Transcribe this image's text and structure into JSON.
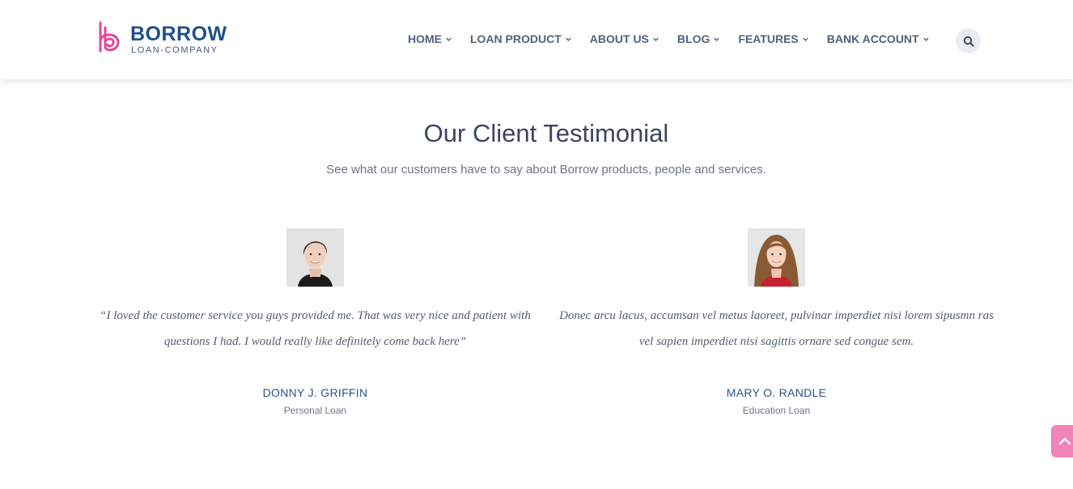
{
  "colors": {
    "brand_primary": "#1f4f8f",
    "brand_accent": "#e0489b",
    "nav_text": "#53617a",
    "heading": "#3c4560",
    "scroll_top_button": "#f184b8"
  },
  "logo": {
    "name": "BORROW",
    "tagline": "LOAN-COMPANY",
    "icon": "borrow-b-monogram-icon"
  },
  "nav": {
    "items": [
      {
        "label": "HOME",
        "icon": "chevron-down-icon"
      },
      {
        "label": "LOAN PRODUCT",
        "icon": "chevron-down-icon"
      },
      {
        "label": "ABOUT US",
        "icon": "chevron-down-icon"
      },
      {
        "label": "BLOG",
        "icon": "chevron-down-icon"
      },
      {
        "label": "FEATURES",
        "icon": "chevron-down-icon"
      },
      {
        "label": "BANK ACCOUNT",
        "icon": "chevron-down-icon"
      }
    ],
    "search_icon": "search-icon"
  },
  "section": {
    "title": "Our Client Testimonial",
    "subtitle": "See what our customers have to say about Borrow products, people and services."
  },
  "testimonials": [
    {
      "quote": "“I loved the customer service you guys provided me. That was very nice and patient with questions I had. I would really like definitely come back here”",
      "name": "DONNY J. GRIFFIN",
      "role": "Personal Loan"
    },
    {
      "quote": "Donec arcu lacus, accumsan vel metus laoreet, pulvinar imperdiet nisi lorem sipusmn ras vel sapien imperdiet nisi sagittis ornare sed congue sem.",
      "name": "MARY O. RANDLE",
      "role": "Education Loan"
    }
  ],
  "scroll_top": {
    "icon": "chevron-up-icon"
  }
}
